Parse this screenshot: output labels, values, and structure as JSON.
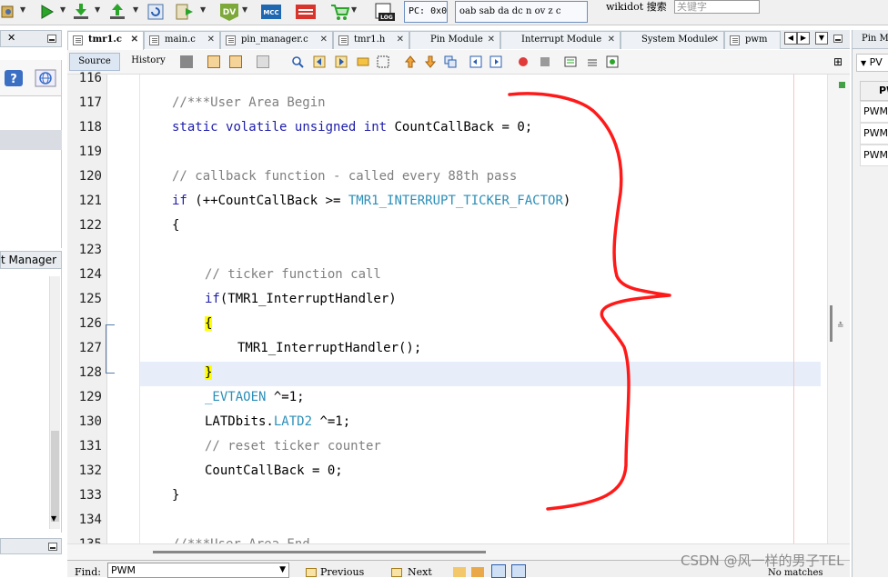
{
  "toolbar": {
    "icons": [
      "run-config-icon",
      "run-icon",
      "build-icon",
      "program-icon",
      "debug-icon",
      "dv-icon",
      "mcc-icon",
      "harmony-icon",
      "cart-icon",
      "log-icon"
    ],
    "pc_label": "PC: 0x0",
    "status_flags": "oab sab da dc n ov z c",
    "search_label": "wikidot 搜索",
    "search_placeholder": "关键字"
  },
  "left_panel": {
    "lower_title": "t Manager"
  },
  "editor_tabs": [
    {
      "label": "tmr1.c",
      "active": true
    },
    {
      "label": "main.c",
      "active": false
    },
    {
      "label": "pin_manager.c",
      "active": false
    },
    {
      "label": "tmr1.h",
      "active": false
    },
    {
      "label": "Pin Module",
      "active": false
    },
    {
      "label": "Interrupt Module",
      "active": false
    },
    {
      "label": "System Module",
      "active": false
    },
    {
      "label": "pwm",
      "active": false
    }
  ],
  "editor_toolbar": {
    "source_label": "Source",
    "history_label": "History"
  },
  "code": {
    "lines": [
      {
        "n": "116",
        "text": ""
      },
      {
        "n": "117",
        "text": "//***User Area Begin"
      },
      {
        "n": "118",
        "text": "static volatile unsigned int CountCallBack = 0;"
      },
      {
        "n": "119",
        "text": ""
      },
      {
        "n": "120",
        "text": "// callback function - called every 88th pass"
      },
      {
        "n": "121",
        "text": "if (++CountCallBack >= TMR1_INTERRUPT_TICKER_FACTOR)"
      },
      {
        "n": "122",
        "text": "{"
      },
      {
        "n": "123",
        "text": ""
      },
      {
        "n": "124",
        "text": "// ticker function call"
      },
      {
        "n": "125",
        "text": "if(TMR1_InterruptHandler)"
      },
      {
        "n": "126",
        "text": "{"
      },
      {
        "n": "127",
        "text": "TMR1_InterruptHandler();"
      },
      {
        "n": "128",
        "text": "}"
      },
      {
        "n": "129",
        "text": "_EVTAOEN ^=1;"
      },
      {
        "n": "130",
        "text": "LATDbits.LATD2 ^=1;"
      },
      {
        "n": "131",
        "text": "// reset ticker counter"
      },
      {
        "n": "132",
        "text": "CountCallBack = 0;"
      },
      {
        "n": "133",
        "text": "}"
      },
      {
        "n": "134",
        "text": ""
      },
      {
        "n": "135",
        "text": "//***User Area End"
      }
    ],
    "tokens": {
      "kw_static": "static",
      "kw_volatile": "volatile",
      "kw_unsigned": "unsigned",
      "kw_int": "int",
      "decl_rest": "CountCallBack = 0;",
      "kw_if": "if",
      "if_open": " (++CountCallBack >= ",
      "macro": "TMR1_INTERRUPT_TICKER_FACTOR",
      "if_close": ")",
      "if2_rest": "(TMR1_InterruptHandler)",
      "evt_mac": "_EVTAOEN",
      "evt_rest": " ^=1;",
      "latd_pre": "LATDbits.",
      "latd_mac": "LATD2",
      "latd_rest": " ^=1;"
    }
  },
  "find_bar": {
    "label": "Find:",
    "value": "PWM",
    "previous": "Previous",
    "next": "Next",
    "result": "No matches"
  },
  "right_panel": {
    "tab_label": "Pin M",
    "header": "PV",
    "col_header": "PW",
    "rows": [
      "PWM",
      "PWM",
      "PWM"
    ]
  },
  "watermark": "CSDN @风一样的男子TEL",
  "colors": {
    "keyword": "#1d1daa",
    "comment": "#7f7f7f",
    "macro": "#2c8fb8",
    "brace_highlight": "#ffff00",
    "annotation": "#ff0000",
    "current_line": "#e8eef9"
  }
}
